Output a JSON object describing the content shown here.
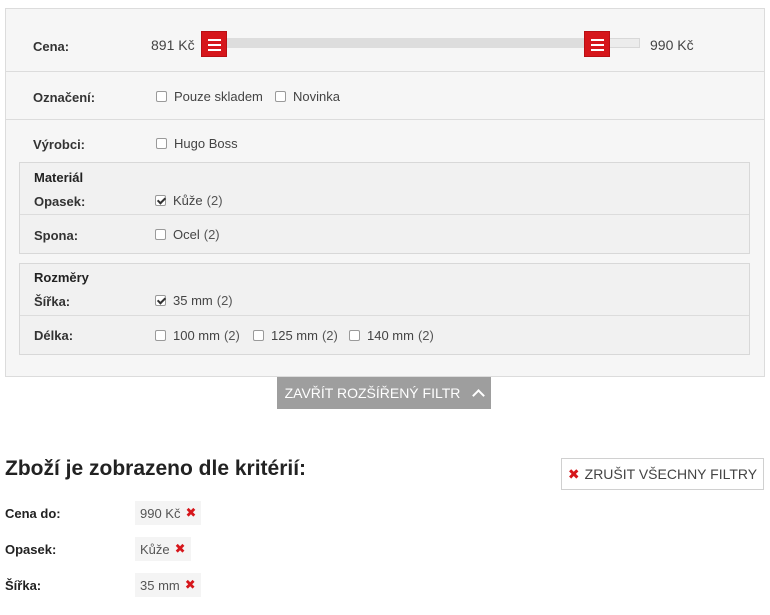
{
  "filter": {
    "price": {
      "label": "Cena:",
      "min_text": "891 Kč",
      "max_text": "990 Kč",
      "range_start_fraction": 0.0,
      "range_end_fraction": 1.0
    },
    "tags": {
      "label": "Označení:",
      "options": [
        {
          "text": "Pouze skladem",
          "checked": false
        },
        {
          "text": "Novinka",
          "checked": false
        }
      ]
    },
    "makers": {
      "label": "Výrobci:",
      "options": [
        {
          "text": "Hugo Boss",
          "checked": false
        }
      ]
    },
    "material": {
      "title": "Materiál",
      "rows": [
        {
          "label": "Opasek:",
          "options": [
            {
              "text": "Kůže",
              "count": "(2)",
              "checked": true
            }
          ]
        },
        {
          "label": "Spona:",
          "options": [
            {
              "text": "Ocel",
              "count": "(2)",
              "checked": false
            }
          ]
        }
      ]
    },
    "dimensions": {
      "title": "Rozměry",
      "rows": [
        {
          "label": "Šířka:",
          "options": [
            {
              "text": "35 mm",
              "count": "(2)",
              "checked": true
            }
          ]
        },
        {
          "label": "Délka:",
          "options": [
            {
              "text": "100 mm",
              "count": "(2)",
              "checked": false
            },
            {
              "text": "125 mm",
              "count": "(2)",
              "checked": false
            },
            {
              "text": "140 mm",
              "count": "(2)",
              "checked": false
            }
          ]
        }
      ]
    },
    "close_button_label": "ZAVŘÍT ROZŠÍŘENÝ FILTR"
  },
  "criteria": {
    "title": "Zboží je zobrazeno dle kritérií:",
    "cancel_all_label": "ZRUŠIT VŠECHNY FILTRY",
    "items": [
      {
        "label": "Cena do:",
        "value": "990 Kč"
      },
      {
        "label": "Opasek:",
        "value": "Kůže"
      },
      {
        "label": "Šířka:",
        "value": "35 mm"
      }
    ]
  },
  "icons": {
    "slider_handle": "hamburger-icon",
    "close_chevron": "chevron-up-icon",
    "remove": "close-x-icon"
  },
  "colors": {
    "accent": "#d6161b",
    "button_gray": "#9e9e9e",
    "panel_bg": "#f6f6f6"
  }
}
